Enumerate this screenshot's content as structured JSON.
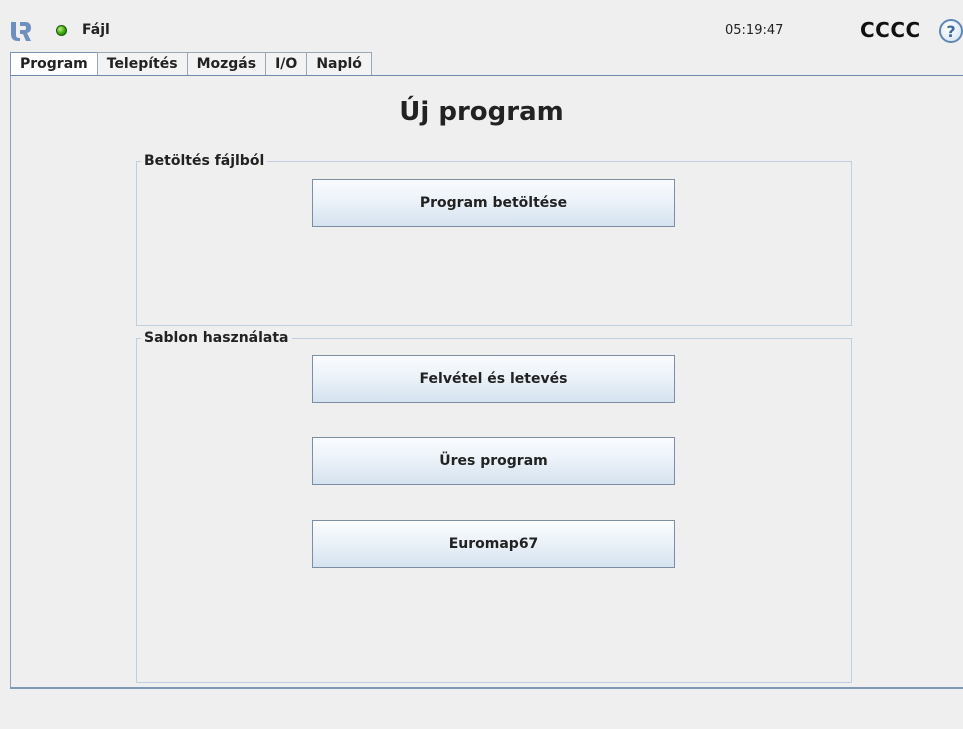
{
  "topbar": {
    "logo_icon": "ur-logo-icon",
    "status_icon": "status-green-dot-icon",
    "status_color": "#3aa40f",
    "file_menu": "Fájl",
    "time": "05:19:47",
    "robot_name": "CCCC",
    "help_icon": "help-question-icon",
    "help_glyph": "?"
  },
  "tabs": [
    {
      "label": "Program",
      "active": true
    },
    {
      "label": "Telepítés",
      "active": false
    },
    {
      "label": "Mozgás",
      "active": false
    },
    {
      "label": "I/O",
      "active": false
    },
    {
      "label": "Napló",
      "active": false
    }
  ],
  "main": {
    "title": "Új program",
    "load_group": {
      "label": "Betöltés fájlból",
      "load_button": "Program betöltése"
    },
    "template_group": {
      "label": "Sablon használata",
      "buttons": [
        "Felvétel és letevés",
        "Üres program",
        "Euromap67"
      ]
    }
  },
  "colors": {
    "background": "#efefef",
    "accent_blue": "#6f8aab",
    "button_border": "#7c8ea4"
  }
}
